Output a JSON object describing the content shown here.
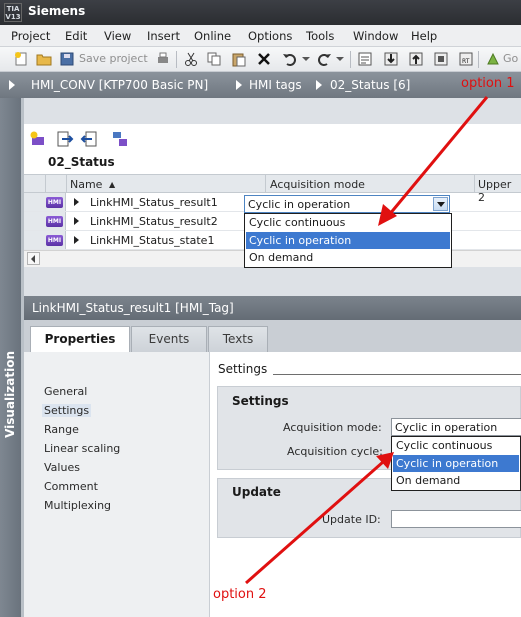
{
  "title_bar": {
    "logo_text": "TIA V13",
    "app_title": "Siemens"
  },
  "menu": [
    "Project",
    "Edit",
    "View",
    "Insert",
    "Online",
    "Options",
    "Tools",
    "Window",
    "Help"
  ],
  "toolbar": {
    "save_label": "Save project",
    "go_label": "Go"
  },
  "breadcrumb": [
    "HMI_CONV [KTP700 Basic PN]",
    "HMI tags",
    "02_Status [6]"
  ],
  "vertical_tab": {
    "label": "Visualization"
  },
  "tag_table": {
    "title": "02_Status",
    "columns": {
      "name": "Name",
      "sort_indicator": "▲",
      "acquisition": "Acquisition mode",
      "upper": "Upper 2"
    },
    "rows": [
      {
        "icon_text": "HMI",
        "name": "LinkHMI_Status_result1"
      },
      {
        "icon_text": "HMI",
        "name": "LinkHMI_Status_result2"
      },
      {
        "icon_text": "HMI",
        "name": "LinkHMI_Status_state1"
      }
    ],
    "acquisition_value": "Cyclic in operation",
    "dropdown_options": [
      "Cyclic continuous",
      "Cyclic in operation",
      "On demand"
    ],
    "selected_option_index": 1
  },
  "inspector": {
    "title": "LinkHMI_Status_result1 [HMI_Tag]",
    "tabs": [
      "Properties",
      "Events",
      "Texts"
    ],
    "active_tab_index": 0,
    "nav_items": [
      "General",
      "Settings",
      "Range",
      "Linear scaling",
      "Values",
      "Comment",
      "Multiplexing"
    ],
    "selected_nav_index": 1,
    "section_header": "Settings",
    "settings_group": {
      "title": "Settings",
      "acquisition_mode_label": "Acquisition mode:",
      "acquisition_mode_value": "Cyclic in operation",
      "acquisition_cycle_label": "Acquisition cycle:"
    },
    "dropdown_options": [
      "Cyclic continuous",
      "Cyclic in operation",
      "On demand"
    ],
    "update_group": {
      "title": "Update",
      "update_id_label": "Update ID:",
      "update_id_value": ""
    }
  },
  "annotations": {
    "option1": "option 1",
    "option2": "option 2",
    "color": "#e01010"
  }
}
